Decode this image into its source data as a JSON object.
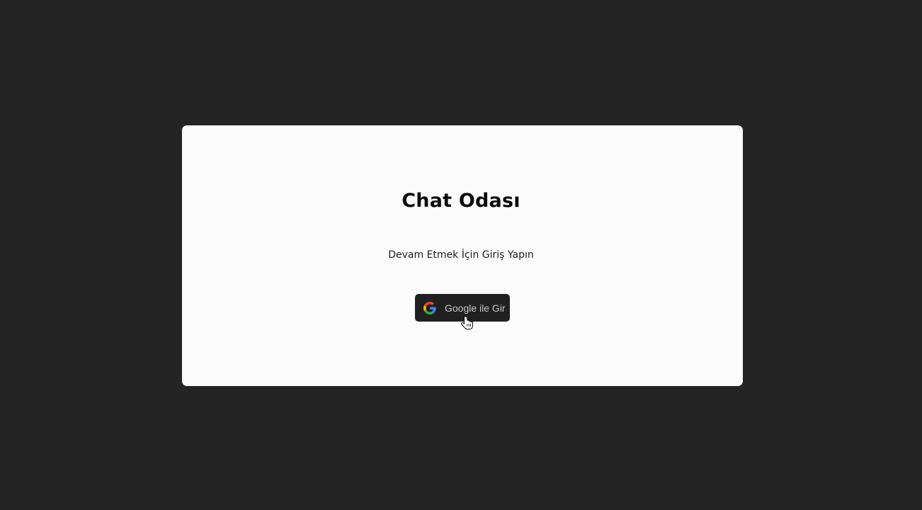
{
  "login": {
    "title": "Chat Odası",
    "subtitle": "Devam Etmek İçin Giriş Yapın",
    "google_button_label": "Google ile Gir"
  },
  "icons": {
    "google": "google-icon",
    "cursor": "hand-pointer-icon"
  },
  "colors": {
    "background": "#252425",
    "card": "#fbfbfb",
    "button": "#202020",
    "button_text": "#c9c9c9"
  }
}
